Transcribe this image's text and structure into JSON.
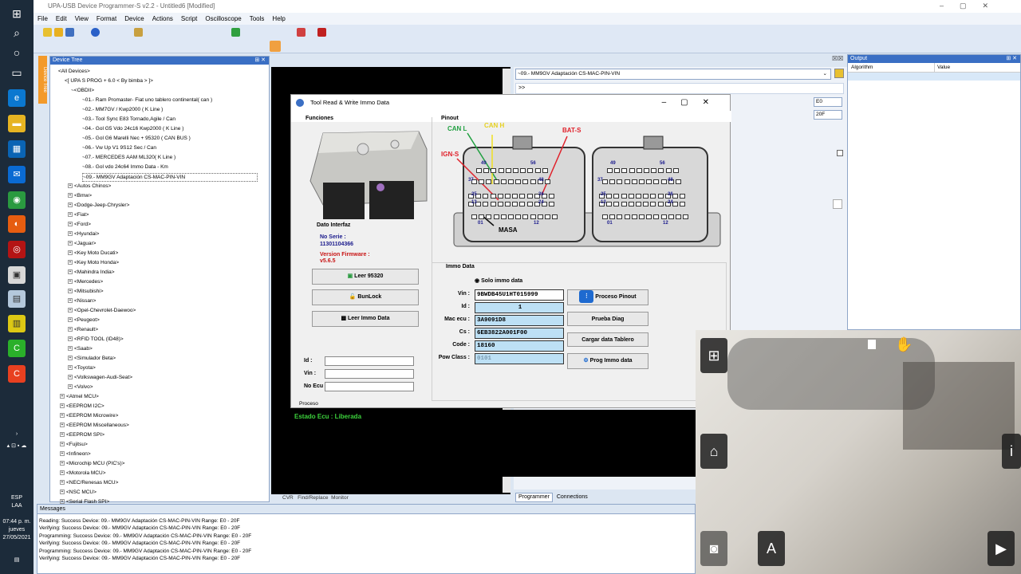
{
  "window": {
    "title": "UPA-USB Device Programmer-S v2.2 - Untitled6 [Modified]"
  },
  "menu": [
    "File",
    "Edit",
    "View",
    "Format",
    "Device",
    "Actions",
    "Script",
    "Oscilloscope",
    "Tools",
    "Help"
  ],
  "tree": {
    "header": "Device Tree",
    "sidetab": "Device Tree",
    "items": [
      "<All Devices>",
      "<[ UPA S PROG + 6.0  < By bimba > ]>",
      "~<OBDII>",
      "~01.- Ram Promaster- Fiat uno tablero continental( can )",
      "~02.- MM7GV / Kwp2000 ( K Line )",
      "~03.- Tool Sync E83 Tornado,Agile / Can",
      "~04.- Gol G5 Vdo 24c16 Kwp2000 ( K Line )",
      "~05.- Gol G6 Marelli Nec + 95320 ( CAN BUS )",
      "~06.- Vw Up V1 9S12 Sec / Can",
      "~07.- MERCEDES AAM ML320( K Line )",
      "~08.- Gol vdo 24c64 Immo Data - Km",
      "~09.- MM9GV Adaptación CS-MAC-PIN-VIN",
      "<Autos Chinos>",
      "<Bmw>",
      "<Dodge-Jeep-Chrysler>",
      "<Fiat>",
      "<Ford>",
      "<Hyundai>",
      "<Jaguar>",
      "<Key Moto Ducati>",
      "<Key Moto Honda>",
      "<Mahindra India>",
      "<Mercedes>",
      "<Mitsubishi>",
      "<Nissan>",
      "<Opel-Chevrolet-Daewoo>",
      "<Peugeot>",
      "<Renault>",
      "<RFID TOOL (ID48)>",
      "<Saab>",
      "<Simulador Beta>",
      "<Toyota>",
      "<Volkswagen-Audi-Seat>",
      "<Volvo>",
      "<Atmel MCU>",
      "<EEPROM I2C>",
      "<EEPROM Microwire>",
      "<EEPROM Miscellaneous>",
      "<EEPROM SPI>",
      "<Fujitsu>",
      "<Infineon>",
      "<Microchip MCU (PIC's)>",
      "<Motorola MCU>",
      "<NEC/Renesas MCU>",
      "<NSC MCU>",
      "<Serial Flash SPI>"
    ]
  },
  "messages": {
    "header": "Messages",
    "lines": [
      "Reading: Success  Device: 09.- MM9GV Adaptación CS-MAC-PIN-VIN Range: E0 - 20F",
      "Verifying: Success  Device: 09.- MM9GV Adaptación CS-MAC-PIN-VIN Range: E0 - 20F",
      "Programming: Success  Device: 09.- MM9GV Adaptación CS-MAC-PIN-VIN Range: E0 - 20F",
      "Verifying: Success  Device: 09.- MM9GV Adaptación CS-MAC-PIN-VIN Range: E0 - 20F",
      "Programming: Success  Device: 09.- MM9GV Adaptación CS-MAC-PIN-VIN Range: E0 - 20F",
      "Verifying: Success  Device: 09.- MM9GV Adaptación CS-MAC-PIN-VIN Range: E0 - 20F"
    ]
  },
  "device_select": {
    "value": "~09.- MM9GV Adaptación CS-MAC-PIN-VIN",
    "cmd": ">>",
    "range_start": "E0",
    "range_end": "20F"
  },
  "output": {
    "header": "Output",
    "col1": "Algorithm",
    "col2": "Value"
  },
  "bottom_tabs": {
    "tab1": "Programmer",
    "tab2": "Connections",
    "code_tabs": [
      "CVR",
      "Find/Replace",
      "Monitor"
    ]
  },
  "dialog": {
    "title": "Tool Read & Write Immo Data",
    "funciones": "Funciones",
    "interfaz": "Dato Interfaz",
    "serie_label": "No Serie :",
    "serie_value": "11301104366",
    "fw_label": "Version Firmware :",
    "fw_value": "v5.6.5",
    "btn_leer95320": "Leer 95320",
    "btn_bunlock": "BunLock",
    "btn_leer_immo": "Leer Immo Data",
    "id_label": "Id :",
    "vin_label": "Vin :",
    "noecu_label": "No Ecu",
    "pinout": "Pinout",
    "wires": {
      "can_l": "CAN L",
      "can_h": "CAN H",
      "bat": "BAT-S",
      "ign": "IGN-S",
      "masa": "MASA"
    },
    "pin_labels": {
      "l49": "49",
      "l56": "56",
      "l37": "37",
      "l48": "48",
      "l25": "25",
      "l36": "36",
      "l13": "13",
      "l24": "24",
      "l01": "01",
      "l12": "12"
    },
    "immo_header": "Immo Data",
    "radio": "Solo immo data",
    "fields": {
      "vin_l": "Vin :",
      "vin_v": "9BWDB45U1HT015999",
      "id_l": "Id :",
      "id_v": "1",
      "mac_l": "Mac ecu :",
      "mac_v": "3A9091D8",
      "cs_l": "Cs :",
      "cs_v": "6EB3822A001F00",
      "code_l": "Code :",
      "code_v": "18160",
      "pow_l": "Pow Class :",
      "pow_v": "0101"
    },
    "btn_pinout": "Proceso Pinout",
    "btn_diag": "Prueba Diag",
    "btn_cargar": "Cargar data Tablero",
    "btn_prog": "Prog Immo data",
    "proceso": "Proceso",
    "estado": "Estado Ecu : Liberada"
  },
  "clock": {
    "time": "07:44 p. m.",
    "day": "jueves",
    "date": "27/05/2021",
    "lang": "ESP",
    "layout": "LAA"
  },
  "colors": {
    "accent": "#3a6fc4",
    "dialog_header": "#7b7b00",
    "estado": "#3cd23c",
    "wire_red": "#e0202a",
    "wire_yellow": "#f0e020",
    "wire_green": "#20a040"
  }
}
